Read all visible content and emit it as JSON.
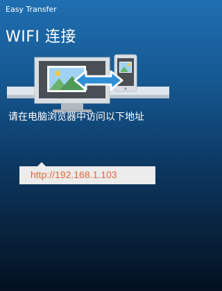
{
  "header": {
    "app_title": "Easy Transfer",
    "page_title": "WIFI 连接"
  },
  "main": {
    "instruction": "请在电脑浏览器中访问以下地址",
    "url": "http://192.168.1.103"
  },
  "colors": {
    "bg_top": "#1f6fb2",
    "bg_bottom": "#031120",
    "url_text": "#e06636",
    "url_box": "#ececec",
    "arrow": "#2f8fd6"
  },
  "icons": [
    "computer-monitor-icon",
    "mobile-phone-icon",
    "transfer-arrow-icon",
    "landscape-image-icon"
  ]
}
